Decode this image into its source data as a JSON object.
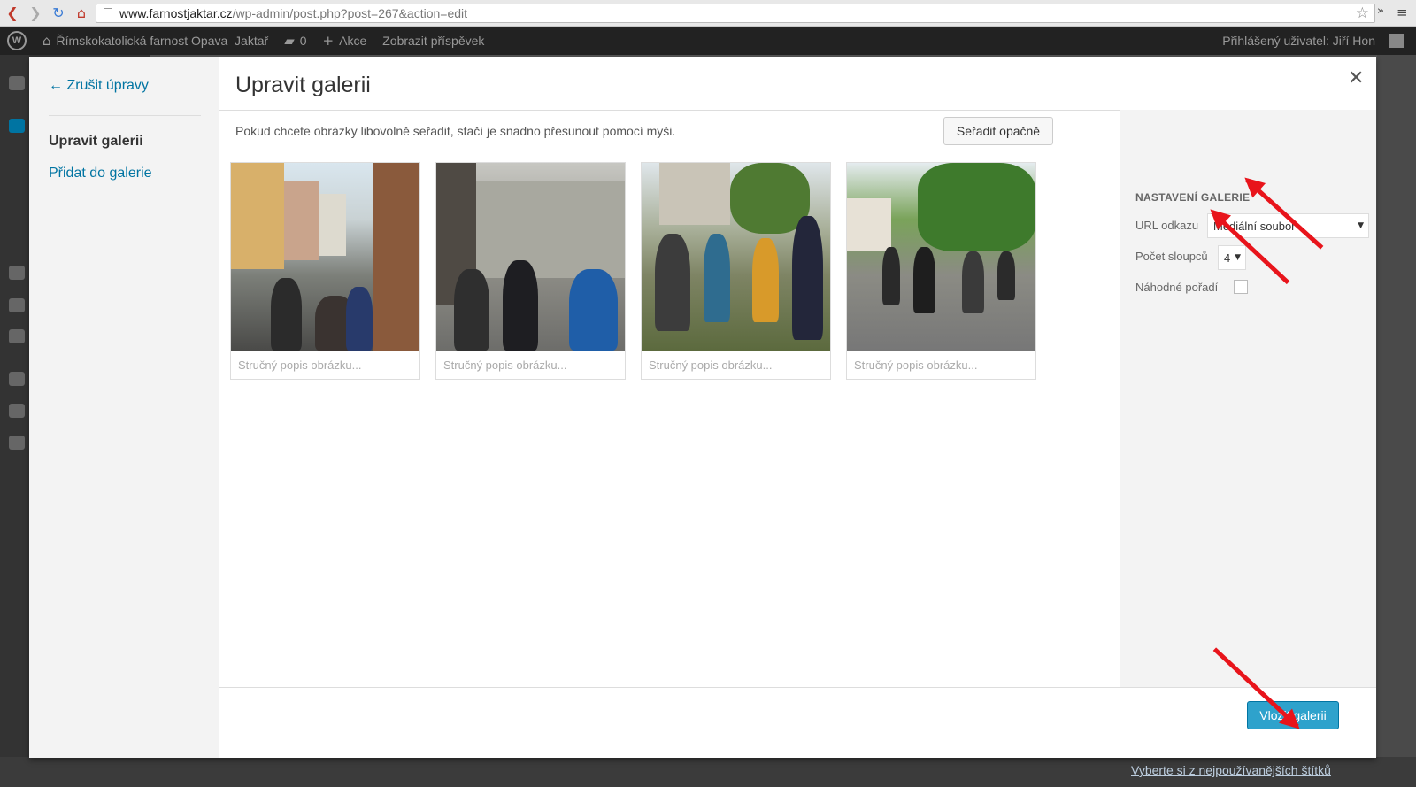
{
  "browser": {
    "url_host": "www.farnostjaktar.cz",
    "url_path": "/wp-admin/post.php?post=267&action=edit"
  },
  "adminbar": {
    "site_name": "Římskokatolická farnost Opava–Jaktař",
    "comments_count": "0",
    "new_label": "Akce",
    "view_post": "Zobrazit příspěvek",
    "user_label": "Přihlášený uživatel: Jiří Hon"
  },
  "sidebar": {
    "cancel": "← Zrušit úpravy",
    "active": "Upravit galerii",
    "add": "Přidat do galerie"
  },
  "modal": {
    "title": "Upravit galerii",
    "instructions": "Pokud chcete obrázky libovolně seřadit, stačí je snadno přesunout pomocí myši.",
    "reverse_button": "Seřadit opačně"
  },
  "gallery": [
    {
      "caption_placeholder": "Stručný popis obrázku..."
    },
    {
      "caption_placeholder": "Stručný popis obrázku..."
    },
    {
      "caption_placeholder": "Stručný popis obrázku..."
    },
    {
      "caption_placeholder": "Stručný popis obrázku..."
    }
  ],
  "settings": {
    "heading": "NASTAVENÍ GALERIE",
    "link_label": "URL odkazu",
    "link_value": "Mediální soubor",
    "columns_label": "Počet sloupců",
    "columns_value": "4",
    "random_label": "Náhodné pořadí",
    "random_checked": false
  },
  "footer": {
    "insert_button": "Vložit galerii"
  },
  "background": {
    "bottom_link": "Vyberte si z nejpoužívanějších štítků"
  },
  "colors": {
    "accent": "#2ea2cc",
    "link": "#0074a2",
    "annotation_arrow": "#e8141b"
  }
}
